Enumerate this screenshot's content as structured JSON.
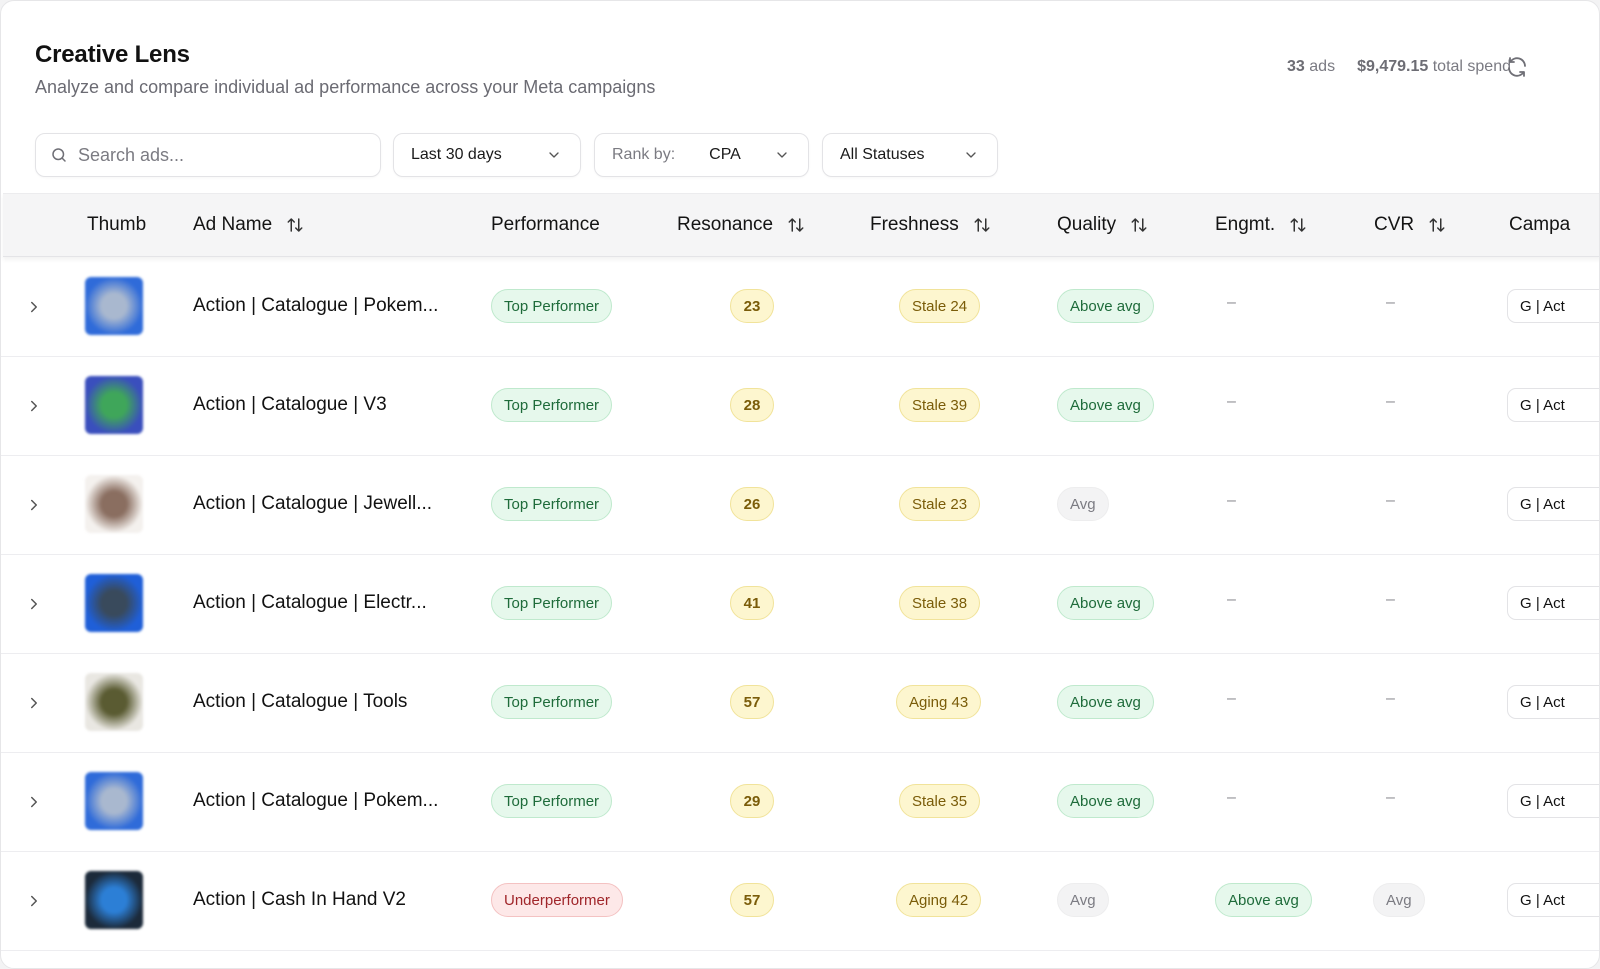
{
  "header": {
    "title": "Creative Lens",
    "subtitle": "Analyze and compare individual ad performance across your Meta campaigns",
    "ads_count": "33",
    "ads_label": "ads",
    "total_spend": "$9,479.15",
    "spend_label": "total spend",
    "refresh_icon": "refresh-icon"
  },
  "filters": {
    "search_placeholder": "Search ads...",
    "date_range": "Last 30 days",
    "rank_label": "Rank by:",
    "rank_value": "CPA",
    "status": "All Statuses"
  },
  "columns": {
    "thumb": "Thumb",
    "ad_name": "Ad Name",
    "performance": "Performance",
    "resonance": "Resonance",
    "freshness": "Freshness",
    "quality": "Quality",
    "engagement": "Engmt.",
    "cvr": "CVR",
    "campaign": "Campa"
  },
  "rows": [
    {
      "ad_name": "Action | Catalogue | Pokem...",
      "performance": "Top Performer",
      "perf_tone": "good",
      "resonance": "23",
      "freshness": "Stale 24",
      "quality": "Above avg",
      "quality_tone": "good",
      "engagement": "–",
      "engagement_tone": "none",
      "cvr": "–",
      "cvr_tone": "none",
      "campaign": "G | Act",
      "thumb_colors": [
        "#2f6bd9",
        "#a9b8cf"
      ]
    },
    {
      "ad_name": "Action | Catalogue | V3",
      "performance": "Top Performer",
      "perf_tone": "good",
      "resonance": "28",
      "freshness": "Stale 39",
      "quality": "Above avg",
      "quality_tone": "good",
      "engagement": "–",
      "engagement_tone": "none",
      "cvr": "–",
      "cvr_tone": "none",
      "campaign": "G | Act",
      "thumb_colors": [
        "#3a4fbd",
        "#3fa65a"
      ]
    },
    {
      "ad_name": "Action | Catalogue | Jewell...",
      "performance": "Top Performer",
      "perf_tone": "good",
      "resonance": "26",
      "freshness": "Stale 23",
      "quality": "Avg",
      "quality_tone": "avg",
      "engagement": "–",
      "engagement_tone": "none",
      "cvr": "–",
      "cvr_tone": "none",
      "campaign": "G | Act",
      "thumb_colors": [
        "#f4f1ee",
        "#8a6e60"
      ]
    },
    {
      "ad_name": "Action | Catalogue | Electr...",
      "performance": "Top Performer",
      "perf_tone": "good",
      "resonance": "41",
      "freshness": "Stale 38",
      "quality": "Above avg",
      "quality_tone": "good",
      "engagement": "–",
      "engagement_tone": "none",
      "cvr": "–",
      "cvr_tone": "none",
      "campaign": "G | Act",
      "thumb_colors": [
        "#1f5fd8",
        "#394a5c"
      ]
    },
    {
      "ad_name": "Action | Catalogue | Tools",
      "performance": "Top Performer",
      "perf_tone": "good",
      "resonance": "57",
      "freshness": "Aging 43",
      "quality": "Above avg",
      "quality_tone": "good",
      "engagement": "–",
      "engagement_tone": "none",
      "cvr": "–",
      "cvr_tone": "none",
      "campaign": "G | Act",
      "thumb_colors": [
        "#e9e7e2",
        "#5a5b32"
      ]
    },
    {
      "ad_name": "Action | Catalogue | Pokem...",
      "performance": "Top Performer",
      "perf_tone": "good",
      "resonance": "29",
      "freshness": "Stale 35",
      "quality": "Above avg",
      "quality_tone": "good",
      "engagement": "–",
      "engagement_tone": "none",
      "cvr": "–",
      "cvr_tone": "none",
      "campaign": "G | Act",
      "thumb_colors": [
        "#2f6bd9",
        "#a9b8cf"
      ]
    },
    {
      "ad_name": "Action | Cash In Hand V2",
      "performance": "Underperformer",
      "perf_tone": "bad",
      "resonance": "57",
      "freshness": "Aging 42",
      "quality": "Avg",
      "quality_tone": "avg",
      "engagement": "Above avg",
      "engagement_tone": "good",
      "cvr": "Avg",
      "cvr_tone": "avg",
      "campaign": "G | Act",
      "thumb_colors": [
        "#1c2a3a",
        "#2c7fd6"
      ]
    }
  ]
}
